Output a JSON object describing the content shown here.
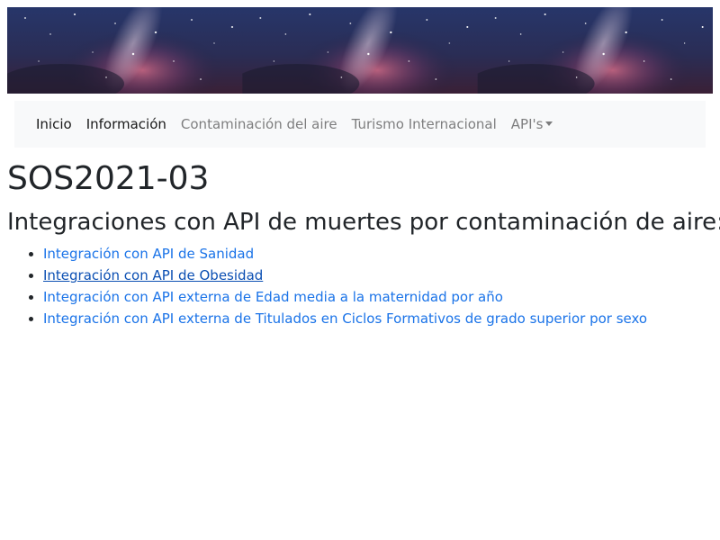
{
  "navbar": {
    "items": [
      {
        "label": "Inicio",
        "active": true
      },
      {
        "label": "Información",
        "active": true
      },
      {
        "label": "Contaminación del aire",
        "active": false
      },
      {
        "label": "Turismo Internacional",
        "active": false
      },
      {
        "label": "API's",
        "active": false,
        "dropdown": true
      }
    ]
  },
  "page": {
    "title": "SOS2021-03",
    "heading": "Integraciones con API de muertes por contaminación de aire:"
  },
  "links": [
    {
      "label": "Integración con API de Sanidad"
    },
    {
      "label": "Integración con API de Obesidad"
    },
    {
      "label": "Integración con API externa de Edad media a la maternidad por año"
    },
    {
      "label": "Integración con API externa de Titulados en Ciclos Formativos de grado superior por sexo"
    }
  ],
  "colors": {
    "link": "#1a73e8",
    "navbar_bg": "#f8f9fa",
    "banner_dark": "#1b2040",
    "banner_glow": "#c25a78"
  }
}
